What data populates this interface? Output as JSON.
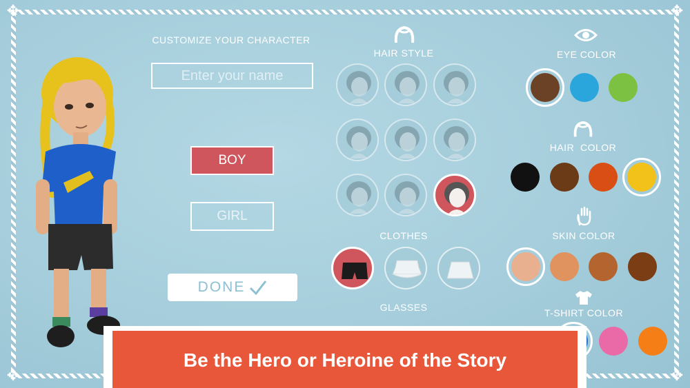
{
  "left_panel": {
    "title": "CUSTOMIZE YOUR CHARACTER",
    "name_placeholder": "Enter your name",
    "boy_label": "BOY",
    "girl_label": "GIRL",
    "done_label": "DONE",
    "done_icon": "checkmark-icon"
  },
  "hair_style": {
    "label": "HAIR STYLE",
    "icon": "hair-icon",
    "options": [
      "curly-short",
      "long-straight",
      "short-crop",
      "afro",
      "buzz-cut",
      "side-part",
      "bob",
      "pigtails",
      "braids"
    ],
    "selected_index": 8
  },
  "clothes": {
    "label": "CLOTHES",
    "options": [
      "shorts",
      "ruffled-skirt",
      "plain-skirt"
    ],
    "selected_index": 0
  },
  "glasses": {
    "label": "GLASSES"
  },
  "eye_color": {
    "label": "EYE COLOR",
    "icon": "eye-icon",
    "swatches": [
      "#6b4225",
      "#2aa6dc",
      "#7dc142"
    ],
    "selected_index": 0
  },
  "hair_color": {
    "label": "HAIR  COLOR",
    "icon": "hair-icon",
    "swatches": [
      "#111111",
      "#6b3a16",
      "#d94e15",
      "#f2c21a"
    ],
    "selected_index": 3
  },
  "skin_color": {
    "label": "SKIN COLOR",
    "icon": "hand-icon",
    "swatches": [
      "#e8b08f",
      "#e0925f",
      "#b4652f",
      "#7a3d14"
    ],
    "selected_index": 0
  },
  "tshirt_color": {
    "label": "T-SHIRT COLOR",
    "icon": "tshirt-icon",
    "swatches": [
      "#1e6fd0",
      "#ea6aa8",
      "#f57e16"
    ],
    "selected_index": 0
  },
  "banner": {
    "text": "Be the Hero or Heroine of the Story"
  },
  "colors": {
    "background": "#a9cfdc",
    "accent_red": "#cf565d",
    "banner_orange": "#e8573a"
  }
}
